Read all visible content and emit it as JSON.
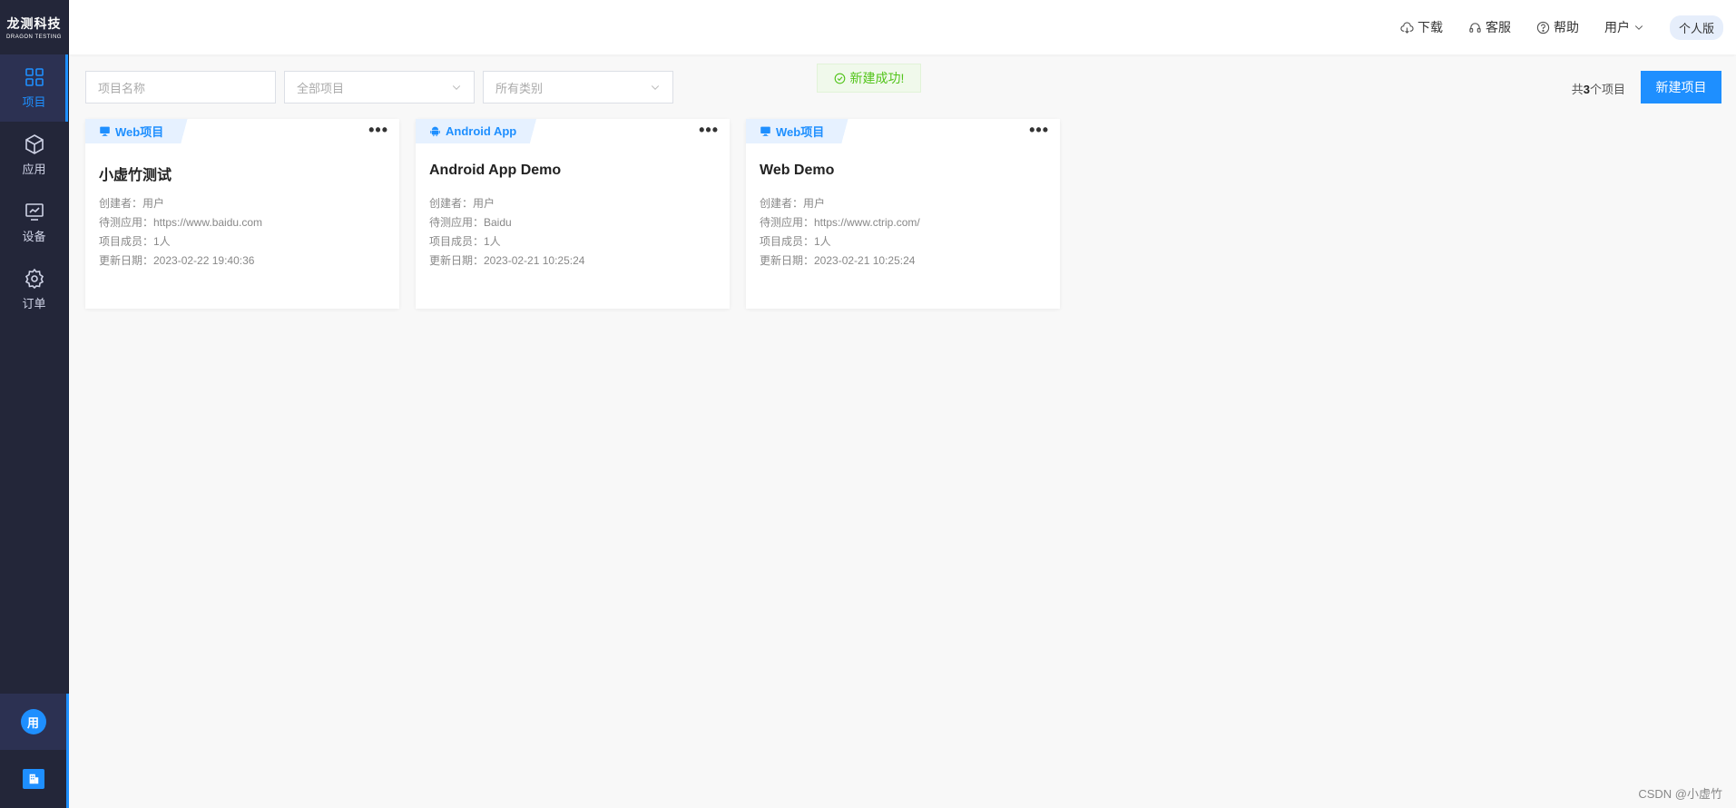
{
  "logo": {
    "cn": "龙测科技",
    "en": "DRAGON TESTING"
  },
  "nav": [
    {
      "label": "项目",
      "icon": "grid-icon",
      "active": true
    },
    {
      "label": "应用",
      "icon": "cube-icon"
    },
    {
      "label": "设备",
      "icon": "monitor-icon"
    },
    {
      "label": "订单",
      "icon": "gear-icon"
    }
  ],
  "user_avatar": "用",
  "header": {
    "download": "下载",
    "service": "客服",
    "help": "帮助",
    "user": "用户",
    "version": "个人版"
  },
  "toolbar": {
    "search_placeholder": "项目名称",
    "filter_all": "全部项目",
    "filter_category": "所有类别"
  },
  "toast": "新建成功!",
  "count": {
    "prefix": "共",
    "number": "3",
    "suffix": "个项目"
  },
  "new_button": "新建项目",
  "cards": [
    {
      "tag": "Web项目",
      "tag_icon": "monitor-icon",
      "title": "小虚竹测试",
      "creator": "创建者：用户",
      "app": "待测应用：https://www.baidu.com",
      "members": "项目成员：1人",
      "updated": "更新日期：2023-02-22 19:40:36"
    },
    {
      "tag": "Android App",
      "tag_icon": "android-icon",
      "title": "Android App Demo",
      "creator": "创建者：用户",
      "app": "待测应用：Baidu",
      "members": "项目成员：1人",
      "updated": "更新日期：2023-02-21 10:25:24"
    },
    {
      "tag": "Web项目",
      "tag_icon": "monitor-icon",
      "title": "Web Demo",
      "creator": "创建者：用户",
      "app": "待测应用：https://www.ctrip.com/",
      "members": "项目成员：1人",
      "updated": "更新日期：2023-02-21 10:25:24"
    }
  ],
  "watermark": "CSDN @小虚竹",
  "colors": {
    "accent": "#1e8fff",
    "sidebar": "#232639",
    "success": "#52c41a"
  }
}
